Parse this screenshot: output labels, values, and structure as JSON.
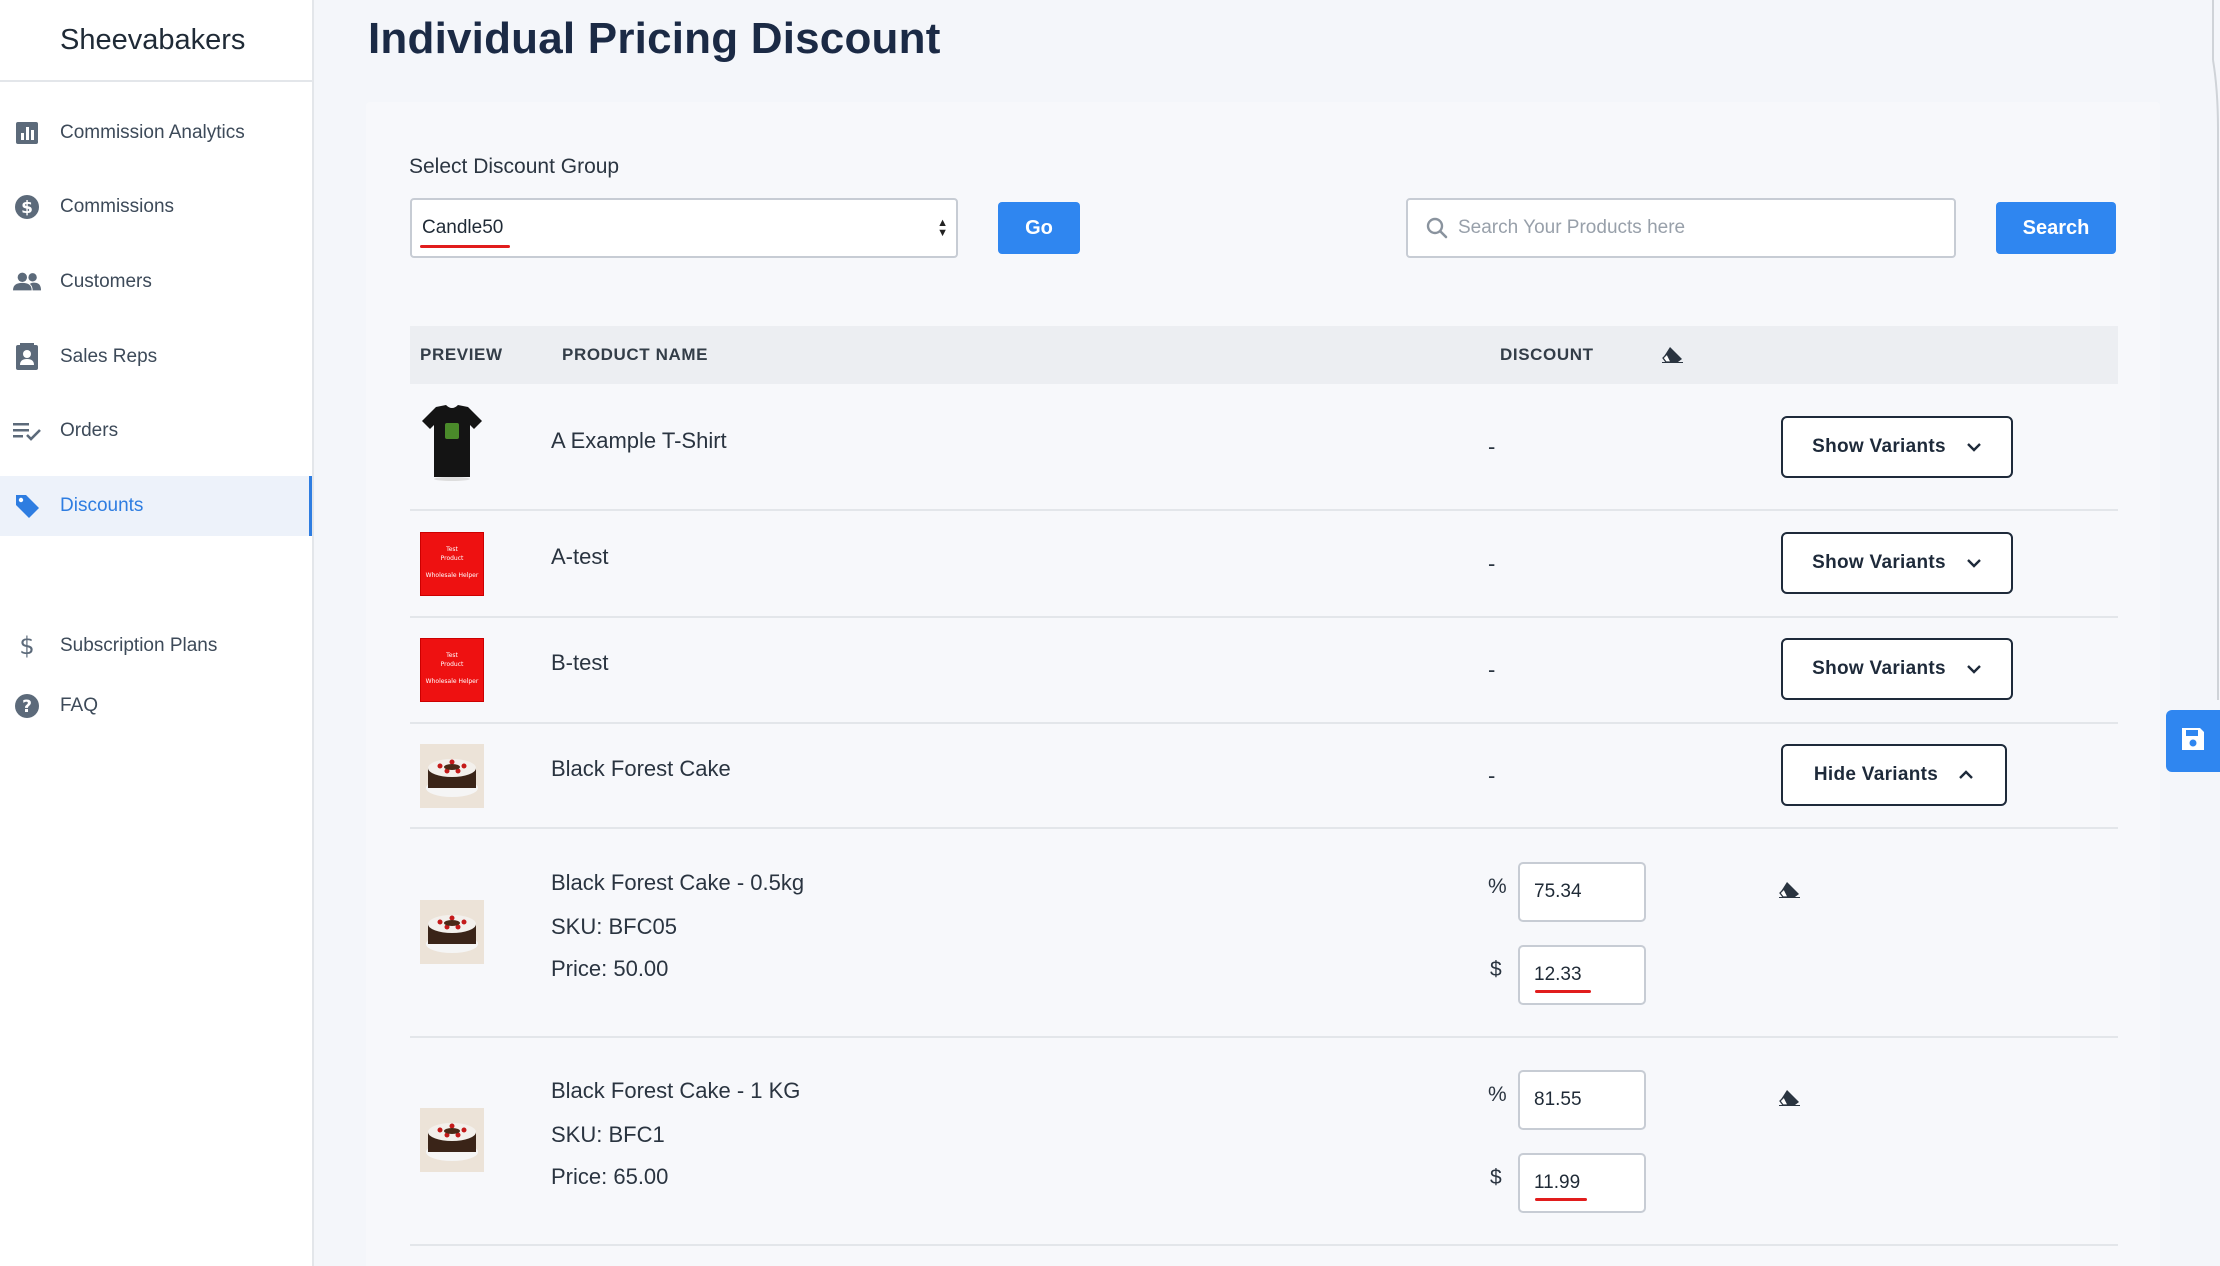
{
  "app": {
    "store_name": "Sheevabakers"
  },
  "sidebar": {
    "items": [
      {
        "label": "Commission Analytics",
        "icon": "bar-chart-icon"
      },
      {
        "label": "Commissions",
        "icon": "dollar-circle-icon"
      },
      {
        "label": "Customers",
        "icon": "users-icon"
      },
      {
        "label": "Sales Reps",
        "icon": "id-card-icon"
      },
      {
        "label": "Orders",
        "icon": "checklist-icon"
      },
      {
        "label": "Discounts",
        "icon": "tag-icon",
        "active": true
      },
      {
        "label": "Subscription Plans",
        "icon": "dollar-icon"
      },
      {
        "label": "FAQ",
        "icon": "question-icon"
      }
    ]
  },
  "page": {
    "title": "Individual Pricing Discount"
  },
  "filters": {
    "select_label": "Select Discount Group",
    "selected_group": "Candle50",
    "go_label": "Go",
    "search_placeholder": "Search Your Products here",
    "search_label": "Search"
  },
  "table": {
    "headers": {
      "preview": "PREVIEW",
      "product_name": "PRODUCT NAME",
      "discount": "DISCOUNT"
    },
    "rows": [
      {
        "name": "A Example T-Shirt",
        "discount": "-",
        "button": "Show Variants",
        "thumb": "tshirt"
      },
      {
        "name": "A-test",
        "discount": "-",
        "button": "Show Variants",
        "thumb": "red-box"
      },
      {
        "name": "B-test",
        "discount": "-",
        "button": "Show Variants",
        "thumb": "red-box"
      },
      {
        "name": "Black Forest Cake",
        "discount": "-",
        "button": "Hide Variants",
        "thumb": "cake"
      }
    ],
    "variants": [
      {
        "name": "Black Forest Cake - 0.5kg",
        "sku": "SKU: BFC05",
        "price": "Price: 50.00",
        "percent_symbol": "%",
        "percent": "75.34",
        "dollar_symbol": "$",
        "dollar": "12.33"
      },
      {
        "name": "Black Forest Cake - 1 KG",
        "sku": "SKU: BFC1",
        "price": "Price: 65.00",
        "percent_symbol": "%",
        "percent": "81.55",
        "dollar_symbol": "$",
        "dollar": "11.99"
      }
    ]
  },
  "thumb_text": {
    "line1": "Test",
    "line2": "Product",
    "line3": "Wholesale Helper"
  },
  "colors": {
    "primary": "#2f86f0",
    "active_nav": "#2e7de1",
    "annotation": "#e11d1d",
    "thumb_red": "#ee1111"
  }
}
